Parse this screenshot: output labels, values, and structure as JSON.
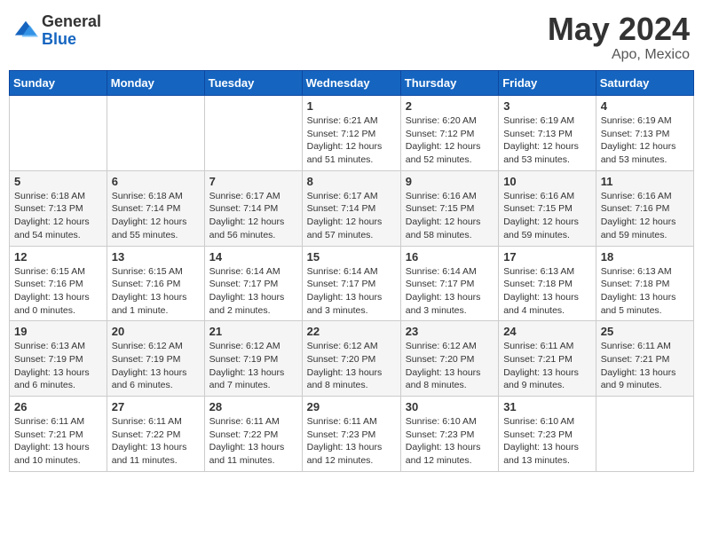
{
  "header": {
    "logo_general": "General",
    "logo_blue": "Blue",
    "month_title": "May 2024",
    "location": "Apo, Mexico"
  },
  "days_of_week": [
    "Sunday",
    "Monday",
    "Tuesday",
    "Wednesday",
    "Thursday",
    "Friday",
    "Saturday"
  ],
  "weeks": [
    [
      {
        "day": "",
        "info": ""
      },
      {
        "day": "",
        "info": ""
      },
      {
        "day": "",
        "info": ""
      },
      {
        "day": "1",
        "info": "Sunrise: 6:21 AM\nSunset: 7:12 PM\nDaylight: 12 hours\nand 51 minutes."
      },
      {
        "day": "2",
        "info": "Sunrise: 6:20 AM\nSunset: 7:12 PM\nDaylight: 12 hours\nand 52 minutes."
      },
      {
        "day": "3",
        "info": "Sunrise: 6:19 AM\nSunset: 7:13 PM\nDaylight: 12 hours\nand 53 minutes."
      },
      {
        "day": "4",
        "info": "Sunrise: 6:19 AM\nSunset: 7:13 PM\nDaylight: 12 hours\nand 53 minutes."
      }
    ],
    [
      {
        "day": "5",
        "info": "Sunrise: 6:18 AM\nSunset: 7:13 PM\nDaylight: 12 hours\nand 54 minutes."
      },
      {
        "day": "6",
        "info": "Sunrise: 6:18 AM\nSunset: 7:14 PM\nDaylight: 12 hours\nand 55 minutes."
      },
      {
        "day": "7",
        "info": "Sunrise: 6:17 AM\nSunset: 7:14 PM\nDaylight: 12 hours\nand 56 minutes."
      },
      {
        "day": "8",
        "info": "Sunrise: 6:17 AM\nSunset: 7:14 PM\nDaylight: 12 hours\nand 57 minutes."
      },
      {
        "day": "9",
        "info": "Sunrise: 6:16 AM\nSunset: 7:15 PM\nDaylight: 12 hours\nand 58 minutes."
      },
      {
        "day": "10",
        "info": "Sunrise: 6:16 AM\nSunset: 7:15 PM\nDaylight: 12 hours\nand 59 minutes."
      },
      {
        "day": "11",
        "info": "Sunrise: 6:16 AM\nSunset: 7:16 PM\nDaylight: 12 hours\nand 59 minutes."
      }
    ],
    [
      {
        "day": "12",
        "info": "Sunrise: 6:15 AM\nSunset: 7:16 PM\nDaylight: 13 hours\nand 0 minutes."
      },
      {
        "day": "13",
        "info": "Sunrise: 6:15 AM\nSunset: 7:16 PM\nDaylight: 13 hours\nand 1 minute."
      },
      {
        "day": "14",
        "info": "Sunrise: 6:14 AM\nSunset: 7:17 PM\nDaylight: 13 hours\nand 2 minutes."
      },
      {
        "day": "15",
        "info": "Sunrise: 6:14 AM\nSunset: 7:17 PM\nDaylight: 13 hours\nand 3 minutes."
      },
      {
        "day": "16",
        "info": "Sunrise: 6:14 AM\nSunset: 7:17 PM\nDaylight: 13 hours\nand 3 minutes."
      },
      {
        "day": "17",
        "info": "Sunrise: 6:13 AM\nSunset: 7:18 PM\nDaylight: 13 hours\nand 4 minutes."
      },
      {
        "day": "18",
        "info": "Sunrise: 6:13 AM\nSunset: 7:18 PM\nDaylight: 13 hours\nand 5 minutes."
      }
    ],
    [
      {
        "day": "19",
        "info": "Sunrise: 6:13 AM\nSunset: 7:19 PM\nDaylight: 13 hours\nand 6 minutes."
      },
      {
        "day": "20",
        "info": "Sunrise: 6:12 AM\nSunset: 7:19 PM\nDaylight: 13 hours\nand 6 minutes."
      },
      {
        "day": "21",
        "info": "Sunrise: 6:12 AM\nSunset: 7:19 PM\nDaylight: 13 hours\nand 7 minutes."
      },
      {
        "day": "22",
        "info": "Sunrise: 6:12 AM\nSunset: 7:20 PM\nDaylight: 13 hours\nand 8 minutes."
      },
      {
        "day": "23",
        "info": "Sunrise: 6:12 AM\nSunset: 7:20 PM\nDaylight: 13 hours\nand 8 minutes."
      },
      {
        "day": "24",
        "info": "Sunrise: 6:11 AM\nSunset: 7:21 PM\nDaylight: 13 hours\nand 9 minutes."
      },
      {
        "day": "25",
        "info": "Sunrise: 6:11 AM\nSunset: 7:21 PM\nDaylight: 13 hours\nand 9 minutes."
      }
    ],
    [
      {
        "day": "26",
        "info": "Sunrise: 6:11 AM\nSunset: 7:21 PM\nDaylight: 13 hours\nand 10 minutes."
      },
      {
        "day": "27",
        "info": "Sunrise: 6:11 AM\nSunset: 7:22 PM\nDaylight: 13 hours\nand 11 minutes."
      },
      {
        "day": "28",
        "info": "Sunrise: 6:11 AM\nSunset: 7:22 PM\nDaylight: 13 hours\nand 11 minutes."
      },
      {
        "day": "29",
        "info": "Sunrise: 6:11 AM\nSunset: 7:23 PM\nDaylight: 13 hours\nand 12 minutes."
      },
      {
        "day": "30",
        "info": "Sunrise: 6:10 AM\nSunset: 7:23 PM\nDaylight: 13 hours\nand 12 minutes."
      },
      {
        "day": "31",
        "info": "Sunrise: 6:10 AM\nSunset: 7:23 PM\nDaylight: 13 hours\nand 13 minutes."
      },
      {
        "day": "",
        "info": ""
      }
    ]
  ]
}
